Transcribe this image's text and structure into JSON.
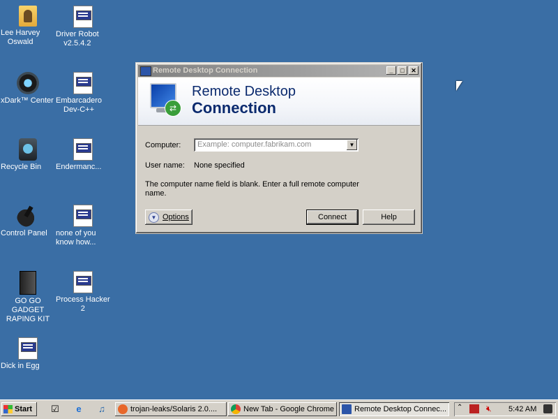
{
  "desktop": {
    "icons": [
      {
        "label": "Lee Harvey\nOswald",
        "icon": "folder-icon"
      },
      {
        "label": "Driver Robot\nv2.5.4.2",
        "icon": "document-icon"
      },
      {
        "label": "xDark™ Center",
        "icon": "ring-icon"
      },
      {
        "label": "Embarcadero\nDev-C++",
        "icon": "document-icon"
      },
      {
        "label": "Recycle Bin",
        "icon": "recycle-bin-icon"
      },
      {
        "label": "Endermanc...",
        "icon": "document-icon"
      },
      {
        "label": "Control Panel",
        "icon": "control-panel-icon"
      },
      {
        "label": "none of you\nknow how...",
        "icon": "document-icon"
      },
      {
        "label": "GO GO GADGET\nRAPING KIT",
        "icon": "gadget-icon"
      },
      {
        "label": "Process Hacker\n2",
        "icon": "document-icon"
      },
      {
        "label": "Dick in Egg",
        "icon": "document-icon"
      }
    ]
  },
  "window": {
    "title": "Remote Desktop Connection",
    "banner_line1": "Remote Desktop",
    "banner_line2": "Connection",
    "computer_label": "Computer:",
    "computer_placeholder": "Example: computer.fabrikam.com",
    "username_label": "User name:",
    "username_value": "None specified",
    "message": "The computer name field is blank. Enter a full remote computer name.",
    "options_label": "Options",
    "connect_label": "Connect",
    "help_label": "Help"
  },
  "taskbar": {
    "start_label": "Start",
    "tasks": [
      {
        "label": "trojan-leaks/Solaris 2.0...."
      },
      {
        "label": "New Tab - Google Chrome"
      },
      {
        "label": "Remote Desktop Connec..."
      }
    ],
    "clock": "5:42 AM"
  },
  "colors": {
    "desktop": "#3a6ea5",
    "banner_text": "#0b2a6e",
    "chrome_face": "#d4d0c8"
  }
}
